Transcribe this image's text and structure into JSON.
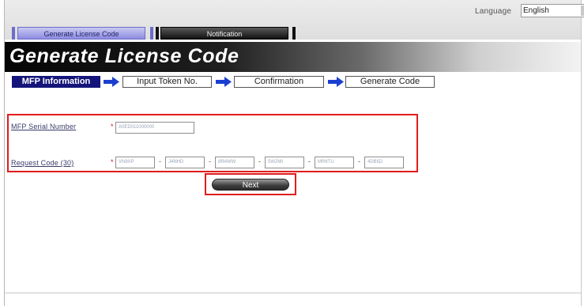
{
  "language": {
    "label": "Language",
    "value": "English"
  },
  "tabs": [
    {
      "label": "Generate License Code"
    },
    {
      "label": "Notification"
    }
  ],
  "page_title": "Generate License Code",
  "steps": [
    {
      "label": "MFP Information"
    },
    {
      "label": "Input Token No."
    },
    {
      "label": "Confirmation"
    },
    {
      "label": "Generate Code"
    }
  ],
  "form": {
    "serial": {
      "label": "MFP Serial Number",
      "required": "*",
      "value": "A0ED011000000"
    },
    "request": {
      "label": "Request Code (30)",
      "required": "*",
      "values": [
        "VN9XP",
        "J4NHD",
        "8R4WW",
        "5W2MI",
        "MR6TU",
        "4DB5D"
      ],
      "separator": "-"
    },
    "next_label": "Next"
  },
  "colors": {
    "active_step": "#14147a",
    "highlight": "#e11c1c",
    "tab_active": "#8c8ce0"
  }
}
